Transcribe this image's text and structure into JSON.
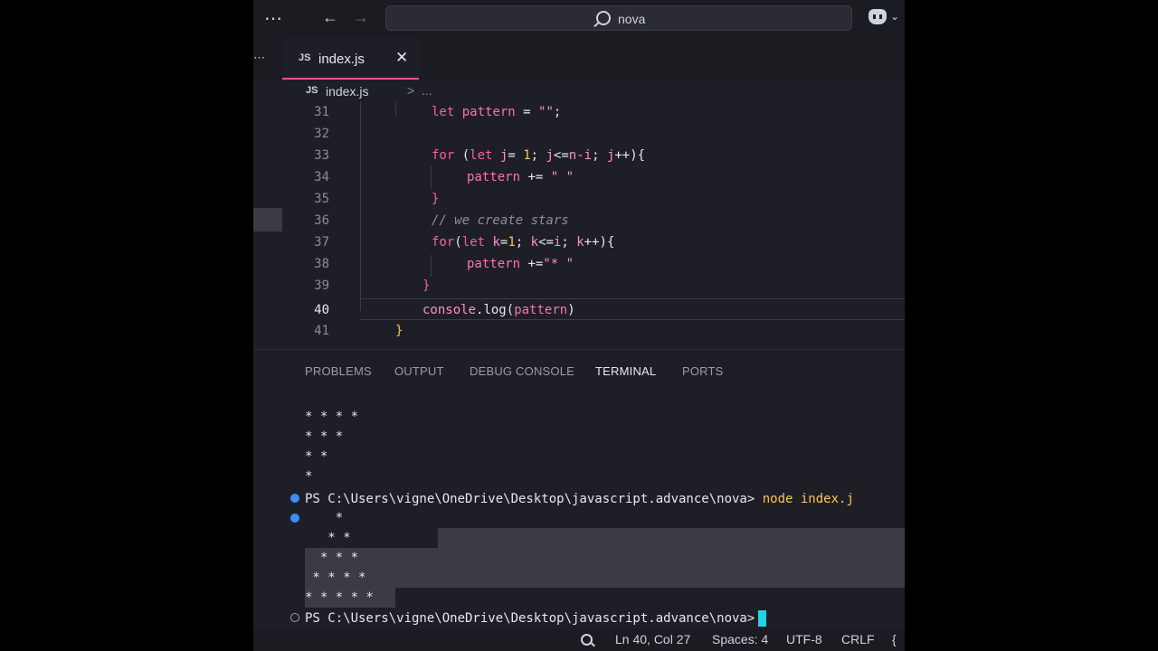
{
  "titlebar": {
    "menu": "⋯",
    "search_text": "nova"
  },
  "tabs": [
    {
      "badge": "JS",
      "label": "index.js",
      "close": "✕"
    }
  ],
  "breadcrumb": {
    "badge": "JS",
    "file": "index.js",
    "sep": ">",
    "more": "..."
  },
  "editor": {
    "lines": [
      31,
      32,
      33,
      34,
      35,
      36,
      37,
      38,
      39,
      40,
      41
    ],
    "current_line": 40
  },
  "panel": {
    "tabs": [
      "PROBLEMS",
      "OUTPUT",
      "DEBUG CONSOLE",
      "TERMINAL",
      "PORTS"
    ],
    "active_tab": "TERMINAL",
    "output_before": [
      "* * * *",
      "* * *",
      "* *",
      "*"
    ],
    "prompt_path": "PS C:\\Users\\vigne\\OneDrive\\Desktop\\javascript.advance\\nova>",
    "command": "node index.j",
    "output_after": [
      "    *",
      "   * *",
      "  * * *",
      " * * * *",
      "* * * * *"
    ],
    "final_prompt": "PS C:\\Users\\vigne\\OneDrive\\Desktop\\javascript.advance\\nova>"
  },
  "status": {
    "position": "Ln 40, Col 27",
    "spaces": "Spaces: 4",
    "encoding": "UTF-8",
    "eol": "CRLF",
    "brace": "{",
    "colors": {
      "accent": "#ff4fa0",
      "cursor": "#21d4e8",
      "keyword": "#ff5ba8",
      "number": "#ffc15e"
    }
  }
}
